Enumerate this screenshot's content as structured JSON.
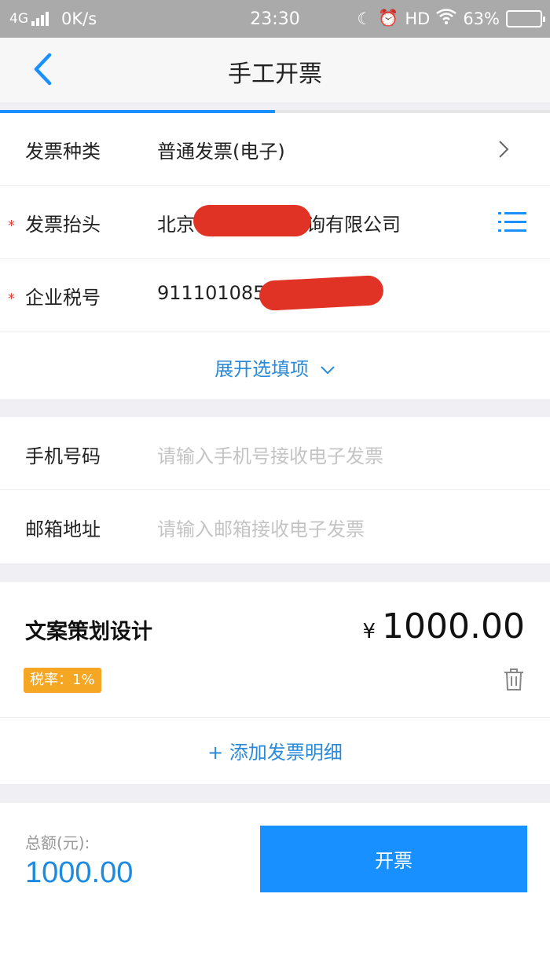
{
  "status_bar": {
    "network": "4G",
    "speed": "0K/s",
    "time": "23:30",
    "hd": "HD",
    "battery": "63%"
  },
  "nav": {
    "title": "手工开票",
    "back_icon": "chevron-left-icon"
  },
  "progress": {
    "fraction": 0.5,
    "color": "#1890ff"
  },
  "invoice": {
    "type": {
      "label": "发票种类",
      "value": "普通发票(电子)"
    },
    "title": {
      "label": "发票抬头",
      "value_start": "北京",
      "value_end": "询有限公司"
    },
    "tax_id": {
      "label": "企业税号",
      "value": "911101085"
    },
    "expand_label": "展开选填项"
  },
  "contact": {
    "phone": {
      "label": "手机号码",
      "placeholder": "请输入手机号接收电子发票"
    },
    "email": {
      "label": "邮箱地址",
      "placeholder": "请输入邮箱接收电子发票"
    }
  },
  "detail": {
    "name": "文案策划设计",
    "currency": "¥",
    "amount": "1000.00",
    "tax_rate": "税率：1%",
    "add_label": "+ 添加发票明细"
  },
  "footer": {
    "total_label": "总额(元):",
    "total_value": "1000.00",
    "submit_label": "开票"
  },
  "colors": {
    "accent": "#1890ff",
    "link": "#2a8ad8",
    "required": "#e8423a",
    "badge": "#f5a623"
  }
}
